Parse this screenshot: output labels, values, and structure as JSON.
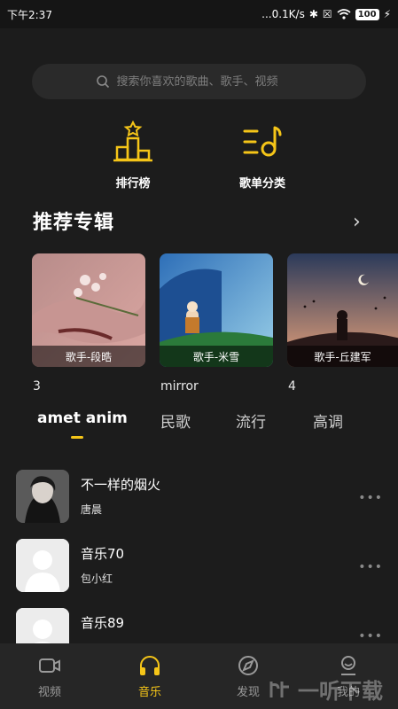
{
  "status_bar": {
    "time": "下午2:37",
    "network": "...0.1K/s",
    "battery": "100"
  },
  "search": {
    "placeholder": "搜索你喜欢的歌曲、歌手、视频"
  },
  "quick_entries": [
    {
      "label": "排行榜",
      "icon": "ranking-podium-icon"
    },
    {
      "label": "歌单分类",
      "icon": "playlist-category-icon"
    }
  ],
  "section": {
    "title": "推荐专辑",
    "more": "›"
  },
  "albums": [
    {
      "caption": "歌手-段晧",
      "title": "3"
    },
    {
      "caption": "歌手-米雪",
      "title": "mirror"
    },
    {
      "caption": "歌手-丘建军",
      "title": "4"
    }
  ],
  "tabs": [
    {
      "label": "amet anim",
      "active": true
    },
    {
      "label": "民歌",
      "active": false
    },
    {
      "label": "流行",
      "active": false
    },
    {
      "label": "高调",
      "active": false
    }
  ],
  "songs": [
    {
      "title": "不一样的烟火",
      "artist": "唐晨",
      "more": "•••"
    },
    {
      "title": "音乐70",
      "artist": "包小红",
      "more": "•••"
    },
    {
      "title": "音乐89",
      "artist": "",
      "more": "•••"
    }
  ],
  "bottom_nav": [
    {
      "label": "视频",
      "icon": "video-icon",
      "active": false
    },
    {
      "label": "音乐",
      "icon": "headphones-icon",
      "active": true
    },
    {
      "label": "发现",
      "icon": "compass-icon",
      "active": false
    },
    {
      "label": "我的",
      "icon": "profile-icon",
      "active": false
    }
  ],
  "watermark": {
    "text": "一听下载"
  },
  "colors": {
    "accent": "#f5c518",
    "background": "#1c1c1c",
    "nav_background": "#262626"
  }
}
